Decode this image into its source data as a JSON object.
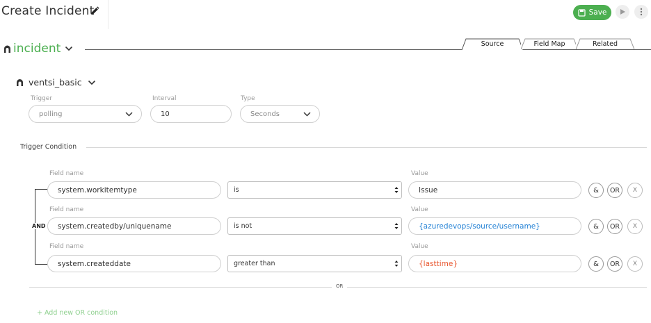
{
  "header": {
    "title": "Create Incident",
    "save_label": "Save",
    "edit_icon": "pencil-icon",
    "save_icon": "save-icon",
    "run_icon": "play-icon",
    "more_icon": "more-vertical-icon"
  },
  "entity": {
    "name": "incident",
    "color": "#4caf50"
  },
  "tabs": [
    {
      "label": "Source",
      "active": true
    },
    {
      "label": "Field Map",
      "active": false
    },
    {
      "label": "Related",
      "active": false
    }
  ],
  "source": {
    "name": "ventsi_basic",
    "trigger": {
      "label": "Trigger",
      "value": "polling"
    },
    "interval": {
      "label": "Interval",
      "value": "10"
    },
    "type": {
      "label": "Type",
      "value": "Seconds"
    }
  },
  "trigger_condition": {
    "label": "Trigger Condition",
    "group_operator": "AND",
    "field_label": "Field name",
    "value_label": "Value",
    "rows": [
      {
        "field": "system.workitemtype",
        "operator": "is",
        "value": "Issue",
        "value_color": "#333333"
      },
      {
        "field": "system.createdby/uniquename",
        "operator": "is not",
        "value": "{azuredevops/source/username}",
        "value_color": "#1f7fd4"
      },
      {
        "field": "system.createddate",
        "operator": "greater than",
        "value": "{lasttime}",
        "value_color": "#e8542c"
      }
    ],
    "and_button": "&",
    "or_button": "OR",
    "remove_button": "X",
    "or_divider": "OR",
    "add_or_label": "+ Add new OR condition"
  }
}
